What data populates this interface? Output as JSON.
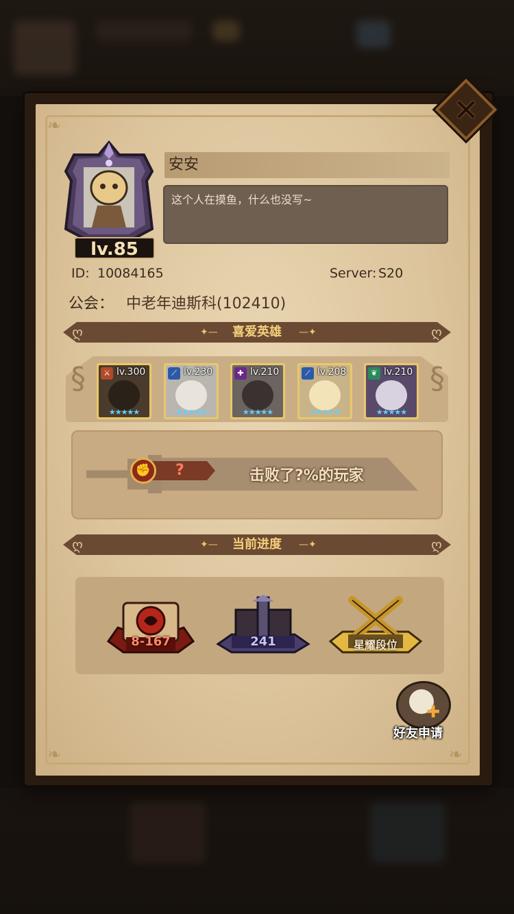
{
  "player": {
    "name": "安安",
    "signature": "这个人在摸鱼，什么也没写~",
    "level": "lv.85",
    "id_label": "ID:",
    "id_value": "10084165",
    "server_label": "Server:",
    "server_value": "S20",
    "guild_label": "公会：",
    "guild_value": "中老年迪斯科(102410)"
  },
  "sections": {
    "favorite_heroes": "喜爱英雄",
    "current_progress": "当前进度"
  },
  "heroes": [
    {
      "level": "lv.300",
      "type_icon": "warrior-icon",
      "type_color": "#b24a2a",
      "stars": "★★★★★",
      "art_color": "#4a3b2c",
      "face_color": "#2a2118"
    },
    {
      "level": "lv.230",
      "type_icon": "sword-icon",
      "type_color": "#2c5aa8",
      "stars": "★★★★★",
      "art_color": "#b9b6b0",
      "face_color": "#e8e4dc"
    },
    {
      "level": "lv.210",
      "type_icon": "healer-icon",
      "type_color": "#6a2a8a",
      "stars": "★★★★★",
      "art_color": "#6b6460",
      "face_color": "#3a3230"
    },
    {
      "level": "lv.208",
      "type_icon": "sword-icon",
      "type_color": "#2c5aa8",
      "stars": "★★★★★",
      "art_color": "#c9b48a",
      "face_color": "#f2e3b8"
    },
    {
      "level": "lv.210",
      "type_icon": "nature-icon",
      "type_color": "#2a8a5a",
      "stars": "★★★★★",
      "art_color": "#5a4a6a",
      "face_color": "#d8d2e0"
    }
  ],
  "defeat": {
    "rank_value": "?",
    "text": "击败了?%的玩家"
  },
  "progress": {
    "campaign": "8-167",
    "tower": "241",
    "rank": "星耀段位"
  },
  "friend_request": {
    "label": "好友申请"
  },
  "colors": {
    "paper": "#dcc49c",
    "banner": "#6b4a33",
    "banner_text": "#f4cf7c",
    "frame": "#2a1b11"
  }
}
